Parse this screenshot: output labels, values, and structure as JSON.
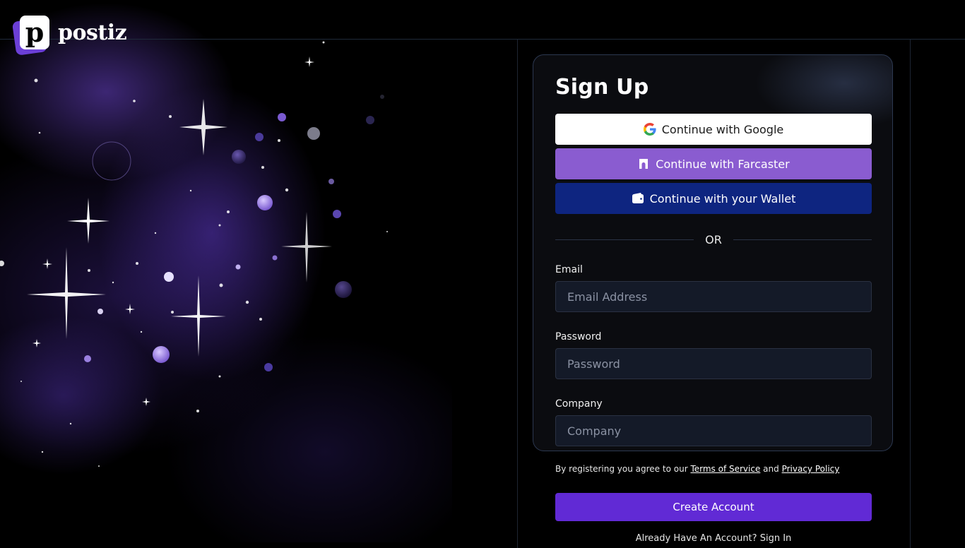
{
  "brand": {
    "logo_letter": "p",
    "name": "postiz"
  },
  "signup": {
    "title": "Sign Up",
    "google_label": "Continue with Google",
    "farcaster_label": "Continue with Farcaster",
    "wallet_label": "Continue with your Wallet",
    "divider_text": "OR",
    "email": {
      "label": "Email",
      "placeholder": "Email Address",
      "value": ""
    },
    "password": {
      "label": "Password",
      "placeholder": "Password",
      "value": ""
    },
    "company": {
      "label": "Company",
      "placeholder": "Company",
      "value": ""
    },
    "terms": {
      "prefix": "By registering you agree to our",
      "tos_link": "Terms of Service",
      "and": "and",
      "privacy_link": "Privacy Policy"
    },
    "create_label": "Create Account",
    "signin_prompt": "Already Have An Account?",
    "signin_link": "Sign In"
  },
  "colors": {
    "google_button": "#ffffff",
    "farcaster_button": "#8a5cd0",
    "wallet_button": "#0e2580",
    "create_button": "#612ad5",
    "input_background": "#141a28"
  }
}
